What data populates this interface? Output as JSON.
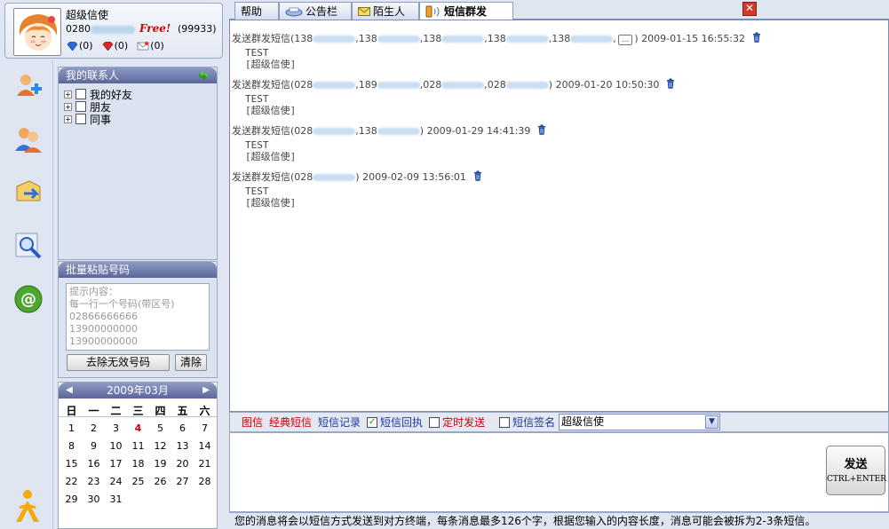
{
  "profile": {
    "name": "超级信使",
    "number_prefix": "0280",
    "free_label": "Free!",
    "points": "(99933)",
    "gem_blue": "(0)",
    "gem_red": "(0)",
    "mail_count": "(0)"
  },
  "contacts": {
    "title": "我的联系人",
    "groups": [
      "我的好友",
      "朋友",
      "同事"
    ]
  },
  "batch": {
    "title": "批量粘贴号码",
    "placeholder": "提示内容：\n每一行一个号码(带区号)\n02866666666\n13900000000\n13900000000",
    "clean_button": "去除无效号码",
    "clear_button": "清除"
  },
  "calendar": {
    "title": "2009年03月",
    "weekdays": [
      "日",
      "一",
      "二",
      "三",
      "四",
      "五",
      "六"
    ],
    "days": [
      "1",
      "2",
      "3",
      "4",
      "5",
      "6",
      "7",
      "8",
      "9",
      "10",
      "11",
      "12",
      "13",
      "14",
      "15",
      "16",
      "17",
      "18",
      "19",
      "20",
      "21",
      "22",
      "23",
      "24",
      "25",
      "26",
      "27",
      "28",
      "29",
      "30",
      "31"
    ],
    "today": "4"
  },
  "tabs": [
    "帮助",
    "公告栏",
    "陌生人",
    "短信群发"
  ],
  "active_tab": "短信群发",
  "messages": [
    {
      "prefix": "发送群发短信(",
      "numbers": [
        "138",
        "138",
        "138",
        "138",
        "138"
      ],
      "has_more": true,
      "timestamp": "2009-01-15 16:55:32",
      "text": "TEST",
      "signature": "[超级信使]"
    },
    {
      "prefix": "发送群发短信(",
      "numbers": [
        "028",
        "189",
        "028",
        "028"
      ],
      "has_more": false,
      "timestamp": "2009-01-20 10:50:30",
      "text": "TEST",
      "signature": "[超级信使]"
    },
    {
      "prefix": "发送群发短信(",
      "numbers": [
        "028",
        "138"
      ],
      "has_more": false,
      "timestamp": "2009-01-29 14:41:39",
      "text": "TEST",
      "signature": "[超级信使]"
    },
    {
      "prefix": "发送群发短信(",
      "numbers": [
        "028"
      ],
      "has_more": false,
      "timestamp": "2009-02-09 13:56:01",
      "text": "TEST",
      "signature": "[超级信使]"
    }
  ],
  "more_label": "...",
  "toolbar": {
    "picture_sms": "图信",
    "classic_sms": "经典短信",
    "sms_records": "短信记录",
    "receipt": "短信回执",
    "receipt_checked": true,
    "scheduled": "定时发送",
    "scheduled_checked": false,
    "signature_label": "短信签名",
    "signature_checked": false,
    "signature_value": "超级信使"
  },
  "send": {
    "label": "发送",
    "shortcut": "CTRL+ENTER"
  },
  "status": "您的消息将会以短信方式发送到对方终端，每条消息最多126个字，根据您输入的内容长度，消息可能会被拆为2-3条短信。",
  "colors": {
    "accent_red": "#d00000",
    "link_blue": "#1c3a9a",
    "panel_header": "#6a76a8"
  }
}
